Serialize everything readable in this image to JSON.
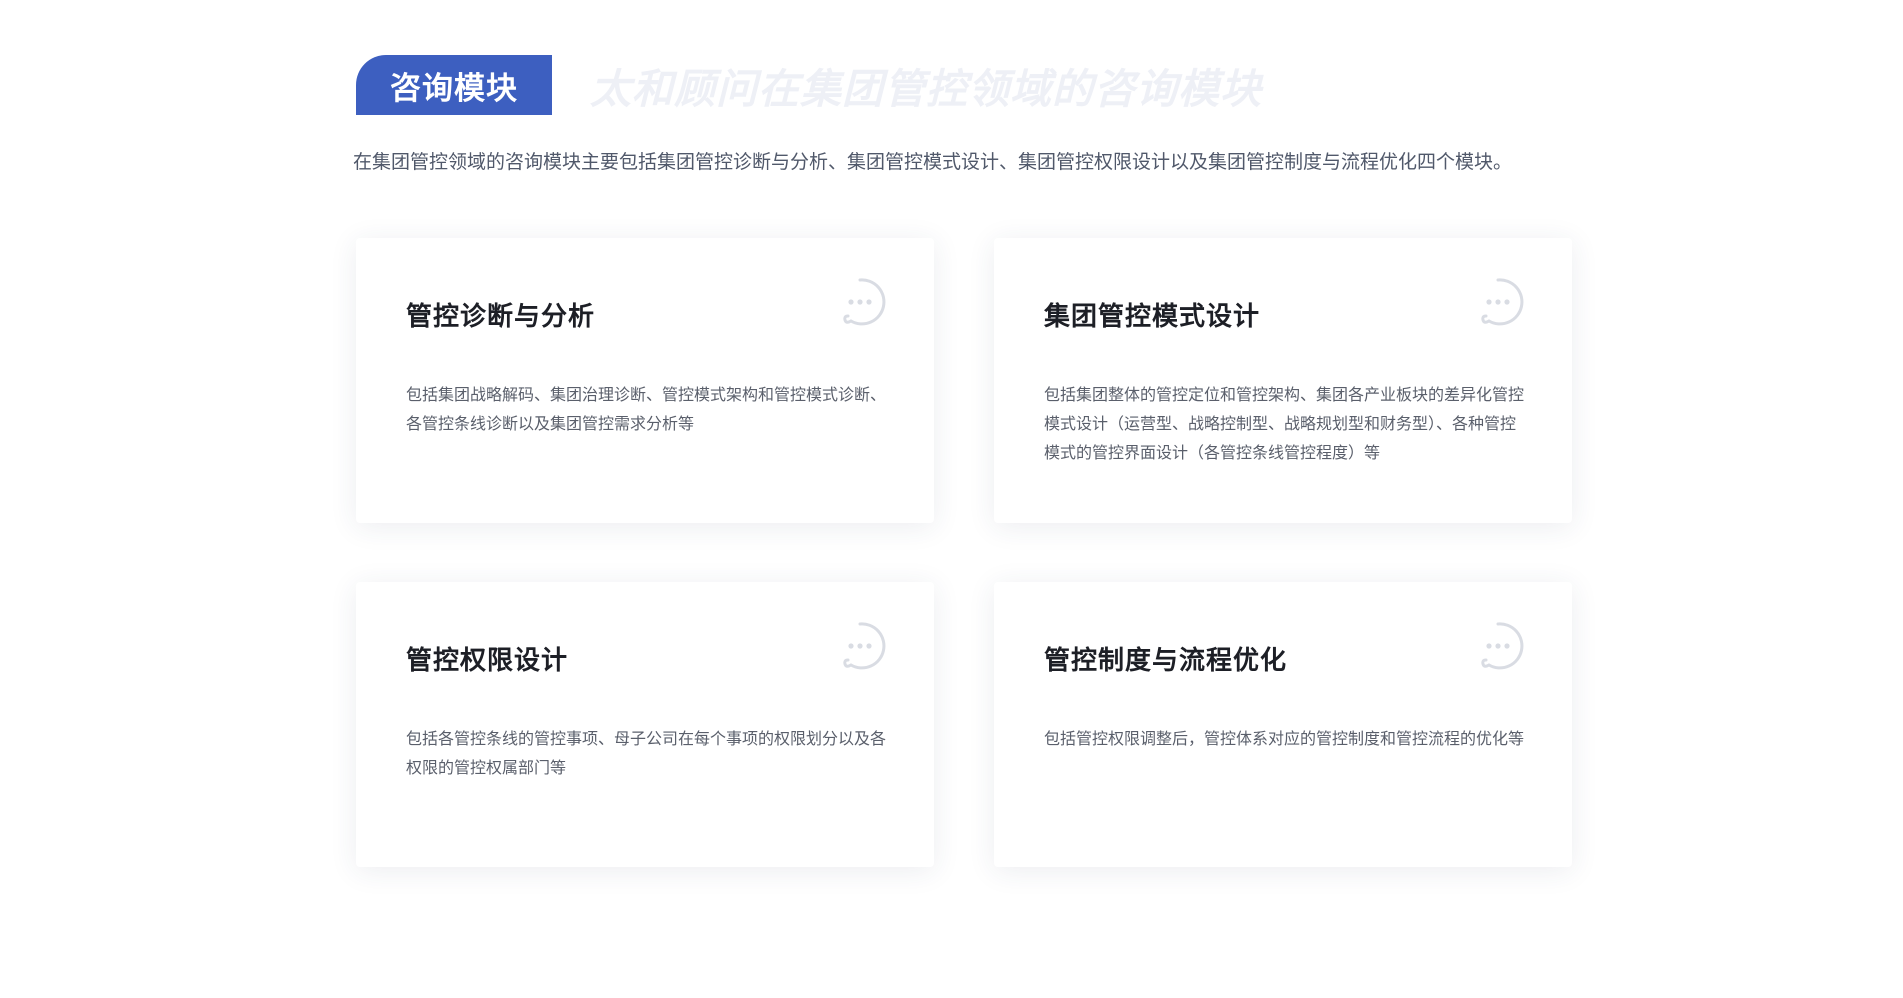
{
  "header": {
    "badge_label": "咨询模块",
    "watermark_text": "太和顾问在集团管控领域的咨询模块"
  },
  "intro": {
    "text": "在集团管控领域的咨询模块主要包括集团管控诊断与分析、集团管控模式设计、集团管控权限设计以及集团管控制度与流程优化四个模块。"
  },
  "cards": [
    {
      "title": "管控诊断与分析",
      "description": "包括集团战略解码、集团治理诊断、管控模式架构和管控模式诊断、各管控条线诊断以及集团管控需求分析等",
      "icon": "chat-bubble-icon"
    },
    {
      "title": "集团管控模式设计",
      "description": "包括集团整体的管控定位和管控架构、集团各产业板块的差异化管控模式设计（运营型、战略控制型、战略规划型和财务型）、各种管控模式的管控界面设计（各管控条线管控程度）等",
      "icon": "chat-bubble-icon"
    },
    {
      "title": "管控权限设计",
      "description": "包括各管控条线的管控事项、母子公司在每个事项的权限划分以及各权限的管控权属部门等",
      "icon": "chat-bubble-icon"
    },
    {
      "title": "管控制度与流程优化",
      "description": "包括管控权限调整后，管控体系对应的管控制度和管控流程的优化等",
      "icon": "chat-bubble-icon"
    }
  ],
  "colors": {
    "accent": "#3d5fc0",
    "watermark": "#eef0f6",
    "icon_stroke": "#d9dce3"
  }
}
